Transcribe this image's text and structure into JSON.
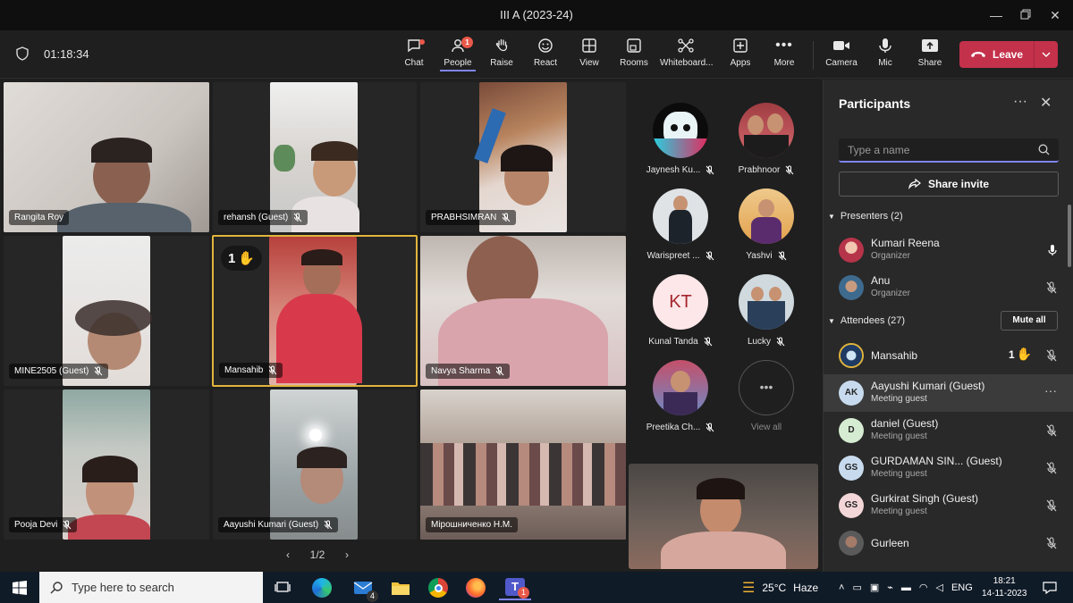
{
  "window": {
    "title": "III A (2023-24)"
  },
  "toolbar": {
    "timer": "01:18:34",
    "buttons": [
      {
        "label": "Chat"
      },
      {
        "label": "People",
        "badge": "1"
      },
      {
        "label": "Raise"
      },
      {
        "label": "React"
      },
      {
        "label": "View"
      },
      {
        "label": "Rooms"
      },
      {
        "label": "Whiteboard..."
      },
      {
        "label": "Apps"
      },
      {
        "label": "More"
      },
      {
        "label": "Camera"
      },
      {
        "label": "Mic"
      },
      {
        "label": "Share"
      }
    ],
    "leave_label": "Leave"
  },
  "tiles": [
    {
      "name": "Rangita Roy"
    },
    {
      "name": "rehansh (Guest)"
    },
    {
      "name": "PRABHSIMRAN"
    },
    {
      "name": "MINE2505 (Guest)"
    },
    {
      "name": "Mansahib",
      "hand": "1"
    },
    {
      "name": "Navya Sharma"
    },
    {
      "name": "Pooja Devi"
    },
    {
      "name": "Aayushi Kumari (Guest)"
    },
    {
      "name": "Мірошниченко Н.М."
    }
  ],
  "gallery": [
    {
      "name": "Jaynesh Ku..."
    },
    {
      "name": "Prabhnoor"
    },
    {
      "name": "Warispreet ..."
    },
    {
      "name": "Yashvi"
    },
    {
      "name": "Kunal Tanda",
      "initials": "KT"
    },
    {
      "name": "Lucky"
    },
    {
      "name": "Preetika Ch..."
    },
    {
      "name": "View all"
    }
  ],
  "pager": {
    "label": "1/2"
  },
  "panel": {
    "title": "Participants",
    "search_placeholder": "Type a name",
    "share_invite": "Share invite",
    "presenters_label": "Presenters (2)",
    "attendees_label": "Attendees (27)",
    "mute_all": "Mute all",
    "presenters": [
      {
        "name": "Kumari Reena",
        "role": "Organizer"
      },
      {
        "name": "Anu",
        "role": "Organizer"
      }
    ],
    "attendees": [
      {
        "name": "Mansahib",
        "role": "",
        "hand": "1"
      },
      {
        "name": "Aayushi Kumari (Guest)",
        "role": "Meeting guest",
        "initials": "AK"
      },
      {
        "name": "daniel (Guest)",
        "role": "Meeting guest",
        "initials": "D"
      },
      {
        "name": "GURDAMAN SIN... (Guest)",
        "role": "Meeting guest",
        "initials": "GS"
      },
      {
        "name": "Gurkirat Singh (Guest)",
        "role": "Meeting guest",
        "initials": "GS"
      },
      {
        "name": "Gurleen",
        "role": ""
      }
    ]
  },
  "taskbar": {
    "search_placeholder": "Type here to search",
    "mail_badge": "4",
    "teams_badge": "1",
    "weather_temp": "25°C",
    "weather_desc": "Haze",
    "lang": "ENG",
    "time": "18:21",
    "date": "14-11-2023"
  },
  "colors": {
    "accent": "#7f85f5",
    "leave": "#c4314b",
    "highlight": "#e1b43c"
  }
}
